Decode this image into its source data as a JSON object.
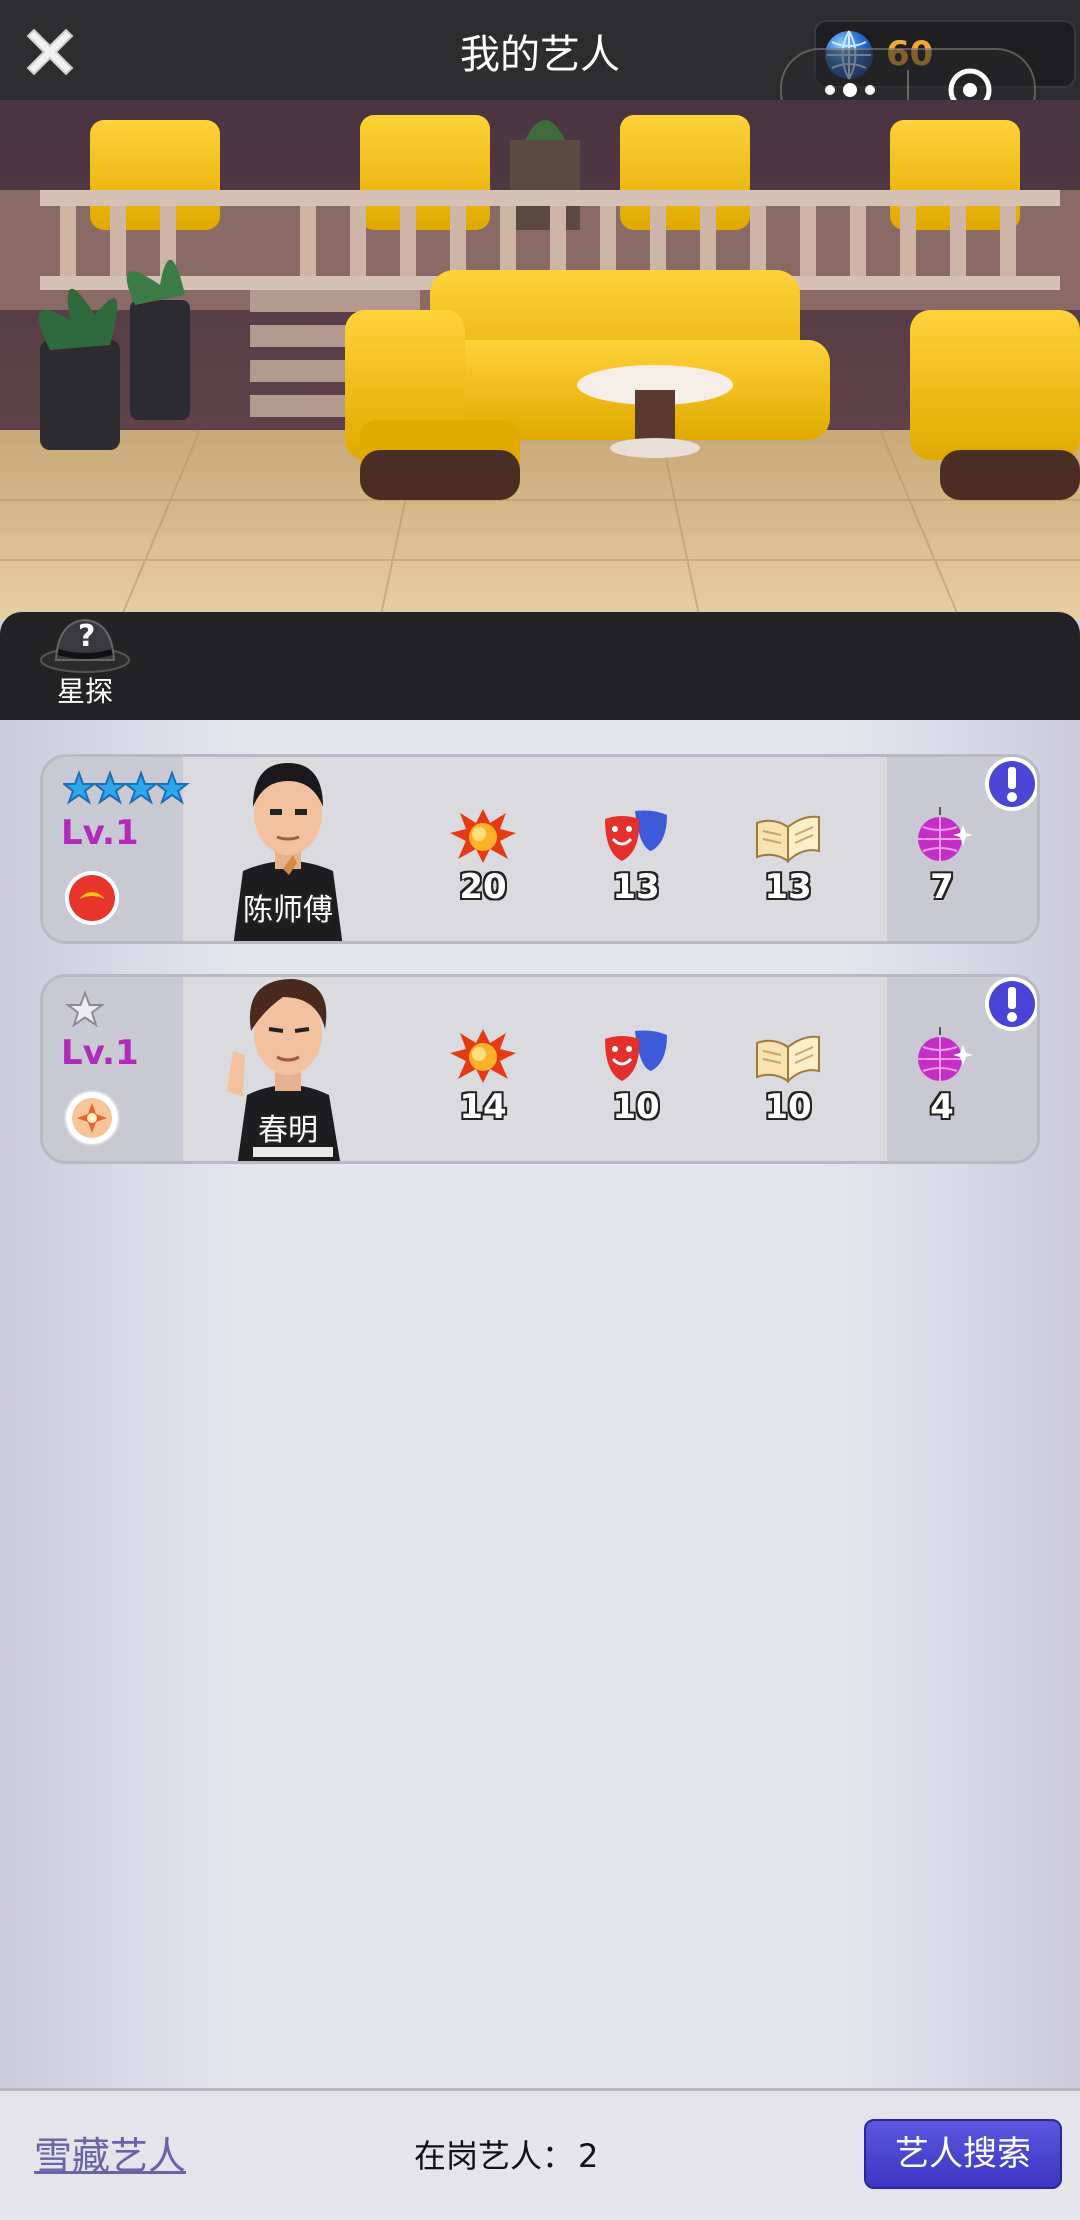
{
  "header": {
    "title": "我的艺人",
    "currency_amount": "60"
  },
  "toolbar": {
    "scout_label": "星探"
  },
  "artists": [
    {
      "name": "陈师傅",
      "level": "Lv.1",
      "stars": 4,
      "star_color": "#2fa7ee",
      "badge_color": "#e8352b",
      "stats": {
        "action": "20",
        "drama": "13",
        "knowledge": "13",
        "glamour": "7"
      }
    },
    {
      "name": "春明",
      "level": "Lv.1",
      "stars": 1,
      "star_color": "#e9e9ee",
      "badge_color": "#f3a267",
      "stats": {
        "action": "14",
        "drama": "10",
        "knowledge": "10",
        "glamour": "4"
      }
    }
  ],
  "footer": {
    "hidden_artists_link": "雪藏艺人",
    "on_duty_label": "在岗艺人：",
    "on_duty_count": "2",
    "search_button": "艺人搜索"
  },
  "colors": {
    "level_text": "#b02cb8",
    "currency_text": "#f0a830",
    "search_button": "#4a45d4",
    "info_button": "#4a45d4"
  },
  "icons": {
    "close": "close-icon",
    "currency": "globe-icon",
    "scout": "detective-hat-icon",
    "stat_action": "explosion-icon",
    "stat_drama": "theater-masks-icon",
    "stat_knowledge": "open-book-icon",
    "stat_glamour": "disco-ball-icon",
    "info": "exclamation-icon"
  }
}
